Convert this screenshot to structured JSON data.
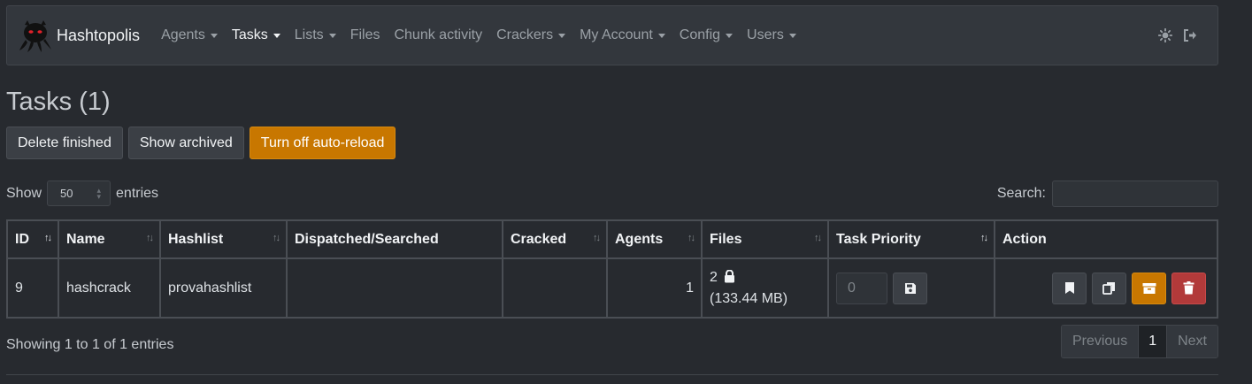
{
  "brand": {
    "name": "Hashtopolis"
  },
  "nav": [
    {
      "label": "Agents",
      "dropdown": true,
      "active": false
    },
    {
      "label": "Tasks",
      "dropdown": true,
      "active": true
    },
    {
      "label": "Lists",
      "dropdown": true,
      "active": false
    },
    {
      "label": "Files",
      "dropdown": false,
      "active": false
    },
    {
      "label": "Chunk activity",
      "dropdown": false,
      "active": false
    },
    {
      "label": "Crackers",
      "dropdown": true,
      "active": false
    },
    {
      "label": "My Account",
      "dropdown": true,
      "active": false
    },
    {
      "label": "Config",
      "dropdown": true,
      "active": false
    },
    {
      "label": "Users",
      "dropdown": true,
      "active": false
    }
  ],
  "nav_right": {
    "theme_icon": "sun-icon",
    "logout_icon": "sign-out-icon"
  },
  "page": {
    "title": "Tasks (1)"
  },
  "buttons": {
    "delete_finished": "Delete finished",
    "show_archived": "Show archived",
    "auto_reload": "Turn off auto-reload"
  },
  "entries": {
    "show_label": "Show",
    "value": "50",
    "suffix": "entries"
  },
  "search": {
    "label": "Search:",
    "value": ""
  },
  "table": {
    "headers": {
      "id": "ID",
      "name": "Name",
      "hashlist": "Hashlist",
      "dispatched": "Dispatched/Searched",
      "cracked": "Cracked",
      "agents": "Agents",
      "files": "Files",
      "priority": "Task Priority",
      "action": "Action"
    },
    "rows": [
      {
        "id": "9",
        "name": "hashcrack",
        "hashlist": "provahashlist",
        "dispatched": "",
        "cracked": "",
        "agents": "1",
        "files_count": "2",
        "files_size": "(133.44 MB)",
        "priority": "0"
      }
    ]
  },
  "footer": {
    "info": "Showing 1 to 1 of 1 entries",
    "previous": "Previous",
    "current_page": "1",
    "next": "Next"
  },
  "colors": {
    "warning": "#c87700",
    "danger": "#b23a3a",
    "background": "#272a2f"
  }
}
